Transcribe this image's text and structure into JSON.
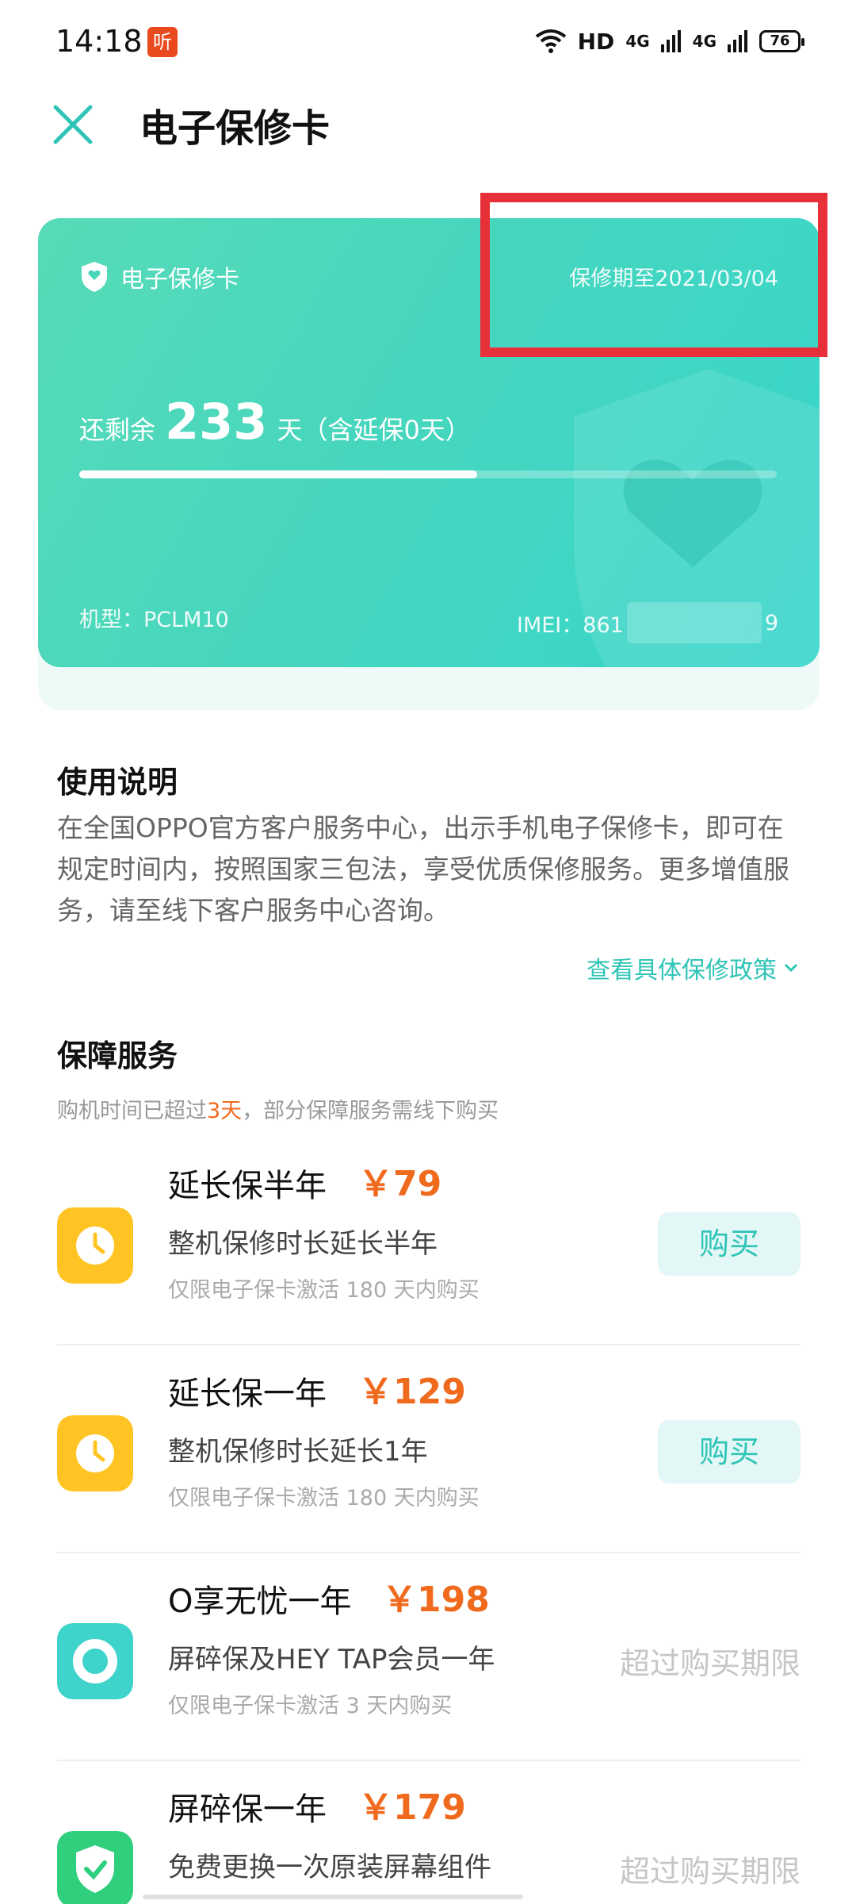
{
  "status_bar": {
    "time": "14:18",
    "app_badge": "听",
    "network_label": "HD",
    "signal1": "4G",
    "signal2": "4G",
    "battery": "76"
  },
  "header": {
    "title": "电子保修卡",
    "close_icon": "close-icon"
  },
  "card": {
    "label": "电子保修卡",
    "expire_text": "保修期至2021/03/04",
    "remaining_prefix": "还剩余",
    "remaining_days": "233",
    "remaining_suffix": "天（含延保0天）",
    "progress": 0.57,
    "model": "机型：PCLM10",
    "imei_prefix": "IMEI：861",
    "imei_suffix": "9",
    "colors": {
      "start": "#57dbb8",
      "end": "#37d5cc"
    }
  },
  "usage": {
    "title": "使用说明",
    "description": "在全国OPPO官方客户服务中心，出示手机电子保修卡，即可在规定时间内，按照国家三包法，享受优质保修服务。更多增值服务，请至线下客户服务中心咨询。",
    "policy_link": "查看具体保修政策"
  },
  "protection": {
    "title": "保障服务",
    "note_prefix": "购机时间已超过",
    "note_highlight": "3天",
    "note_suffix": "，部分保障服务需线下购买",
    "services": [
      {
        "name": "延长保半年",
        "price": "￥79",
        "desc": "整机保修时长延长半年",
        "limit": "仅限电子保卡激活 180 天内购买",
        "action": "购买",
        "icon": "clock-icon",
        "icon_color": "#ffc423"
      },
      {
        "name": "延长保一年",
        "price": "￥129",
        "desc": "整机保修时长延长1年",
        "limit": "仅限电子保卡激活 180 天内购买",
        "action": "购买",
        "icon": "clock-icon",
        "icon_color": "#ffc423"
      },
      {
        "name": "O享无忧一年",
        "price": "￥198",
        "desc": "屏碎保及HEY TAP会员一年",
        "limit": "仅限电子保卡激活 3 天内购买",
        "action": "超过购买期限",
        "icon": "ring-icon",
        "icon_color": "#3fd4cb"
      },
      {
        "name": "屏碎保一年",
        "price": "￥179",
        "desc": "免费更换一次原装屏幕组件",
        "limit": "",
        "action": "超过购买期限",
        "icon": "shield-check-icon",
        "icon_color": "#2fcf7e"
      }
    ]
  },
  "accent_color": "#2ec4b6",
  "price_color": "#f06a1e"
}
